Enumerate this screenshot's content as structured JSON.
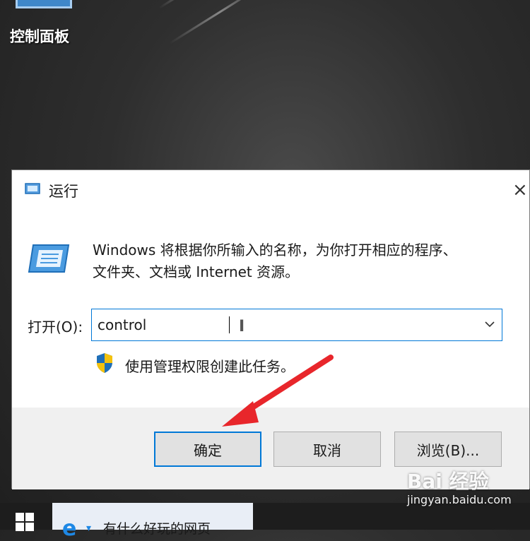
{
  "desktop": {
    "icon_label": "控制面板"
  },
  "dialog": {
    "title": "运行",
    "close_glyph": "×",
    "description_line1": "Windows 将根据你所输入的名称，为你打开相应的程序、",
    "description_line2": "文件夹、文档或 Internet 资源。",
    "open_label": "打开(O):",
    "open_value": "control",
    "admin_note": "使用管理权限创建此任务。",
    "buttons": {
      "ok": "确定",
      "cancel": "取消",
      "browse": "浏览(B)..."
    }
  },
  "taskbar": {
    "task_title": "有什么好玩的网页"
  },
  "watermark": {
    "logo": "Bai 经验",
    "url": "jingyan.baidu.com"
  },
  "icons": {
    "title": "run-icon",
    "big": "run-icon",
    "dropdown": "chevron-down-icon",
    "shield": "uac-shield-icon",
    "start": "windows-logo-icon",
    "browser": "ie-icon"
  },
  "colors": {
    "accent": "#0078d7",
    "annotation_arrow": "#e8262b"
  }
}
